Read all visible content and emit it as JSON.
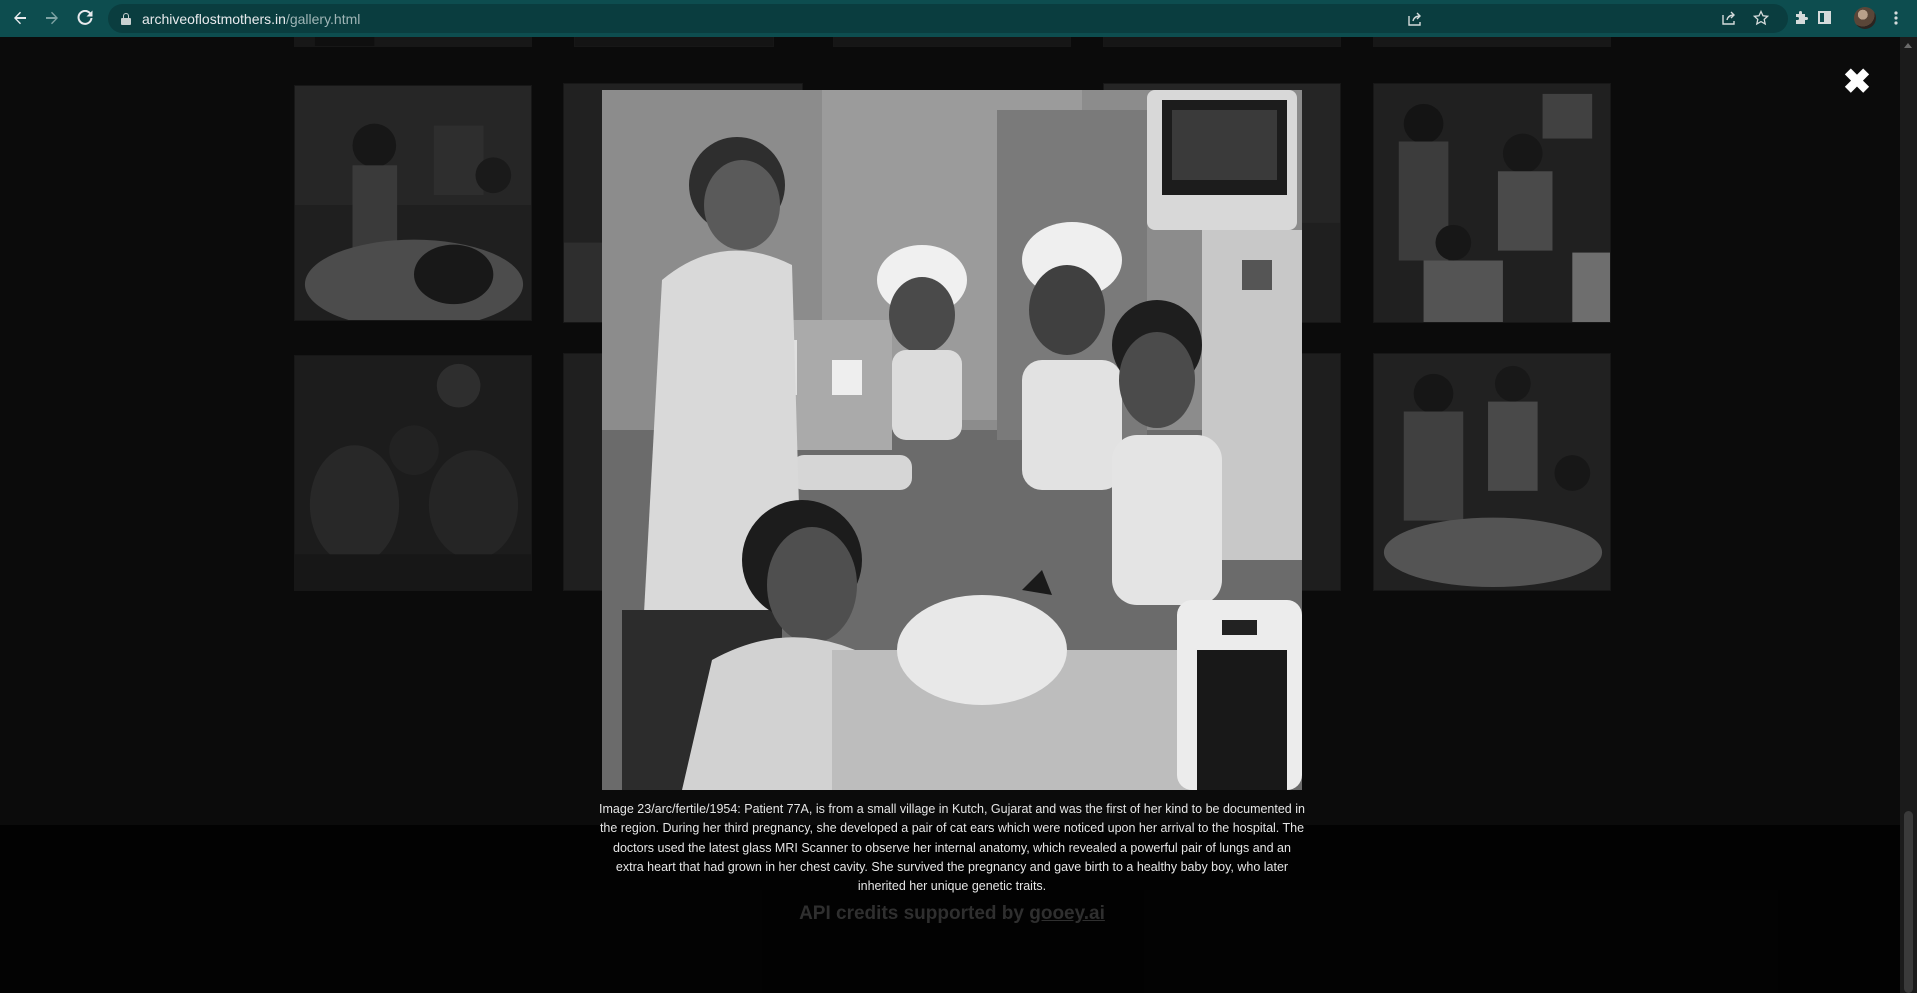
{
  "browser": {
    "url_domain": "archiveoflostmothers.in",
    "url_path": "/gallery.html",
    "back_icon": "arrow-left-icon",
    "forward_icon": "arrow-right-icon",
    "reload_icon": "reload-icon",
    "share_icon": "share-icon",
    "bookmark_icon": "star-icon",
    "extensions_icon": "puzzle-icon",
    "sidepanel_icon": "side-panel-icon",
    "menu_icon": "kebab-menu-icon",
    "theme_color": "#0d4d4f"
  },
  "lightbox": {
    "close_glyph": "✖",
    "caption": "Image 23/arc/fertile/1954: Patient 77A, is from a small village in Kutch, Gujarat and was the first of her kind to be documented in the region. During her third pregnancy, she developed a pair of cat ears which were noticed upon her arrival to the hospital. The doctors used the latest glass MRI Scanner to observe her internal anatomy, which revealed a powerful pair of lungs and an extra heart that had grown in her chest cavity. She survived the pregnancy and gave birth to a healthy baby boy, who later inherited her unique genetic traits."
  },
  "footer": {
    "credits_prefix": "API credits supported by ",
    "credits_link": "gooey.ai"
  }
}
